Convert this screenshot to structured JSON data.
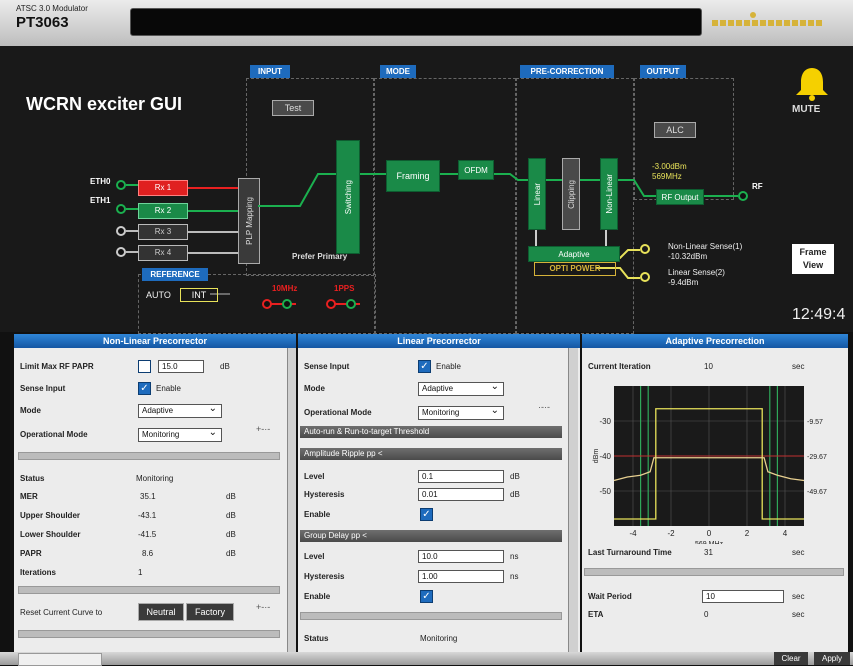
{
  "window": {
    "subtitle": "ATSC 3.0 Modulator",
    "model": "PT3063"
  },
  "diagram": {
    "title": "WCRN exciter GUI",
    "sections": {
      "input": "INPUT",
      "mode": "MODE",
      "precorrection": "PRE-CORRECTION",
      "output": "OUTPUT"
    },
    "test_button": "Test",
    "ports": {
      "eth0": "ETH0",
      "eth1": "ETH1",
      "rf": "RF"
    },
    "rx": [
      "Rx 1",
      "Rx 2",
      "Rx 3",
      "Rx 4"
    ],
    "plp_mapping": "PLP Mapping",
    "switching": "Switching",
    "prefer_primary": "Prefer Primary",
    "framing": "Framing",
    "ofdm": "OFDM",
    "linear": "Linear",
    "clipping": "Clipping",
    "non_linear": "Non-Linear",
    "adaptive": "Adaptive",
    "optipower": "OPTI POWER",
    "alc": "ALC",
    "output_level": "-3.00dBm",
    "output_freq": "569MHz",
    "rf_output": "RF Output",
    "reference": "REFERENCE",
    "auto": "AUTO",
    "int": "INT",
    "ref_10mhz": "10MHz",
    "ref_1pps": "1PPS",
    "nl_sense_label": "Non-Linear Sense(1)",
    "nl_sense_value": "-10.32dBm",
    "lin_sense_label": "Linear Sense(2)",
    "lin_sense_value": "-9.4dBm",
    "mute": "MUTE",
    "frame_view": "Frame View",
    "clock": "12:49:4"
  },
  "nonlinear": {
    "header": "Non-Linear Precorrector",
    "limit_label": "Limit Max RF PAPR",
    "limit_value": "15.0",
    "limit_unit": "dB",
    "sense_label": "Sense Input",
    "enable": "Enable",
    "mode_label": "Mode",
    "mode_value": "Adaptive",
    "op_label": "Operational Mode",
    "op_value": "Monitoring",
    "status_label": "Status",
    "status_value": "Monitoring",
    "stats": [
      {
        "label": "MER",
        "value": "35.1",
        "unit": "dB"
      },
      {
        "label": "Upper Shoulder",
        "value": "-43.1",
        "unit": "dB"
      },
      {
        "label": "Lower Shoulder",
        "value": "-41.5",
        "unit": "dB"
      },
      {
        "label": "PAPR",
        "value": "8.6",
        "unit": "dB"
      },
      {
        "label": "Iterations",
        "value": "1",
        "unit": ""
      }
    ],
    "reset_label": "Reset Current Curve to",
    "neutral": "Neutral",
    "factory": "Factory"
  },
  "linear": {
    "header": "Linear Precorrector",
    "sense_label": "Sense Input",
    "enable": "Enable",
    "mode_label": "Mode",
    "mode_value": "Adaptive",
    "op_label": "Operational Mode",
    "op_value": "Monitoring",
    "auto_run": "Auto-run & Run-to-target Threshold",
    "amp_ripple": "Amplitude Ripple pp <",
    "level_label": "Level",
    "amp_level": "0.1",
    "amp_level_unit": "dB",
    "hyst_label": "Hysteresis",
    "amp_hyst": "0.01",
    "amp_hyst_unit": "dB",
    "enable_label": "Enable",
    "group_delay": "Group Delay pp <",
    "gd_level": "10.0",
    "gd_level_unit": "ns",
    "gd_hyst": "1.00",
    "gd_hyst_unit": "ns",
    "status_label": "Status",
    "status_value": "Monitoring"
  },
  "adaptive": {
    "header": "Adaptive Precorrection",
    "iter_label": "Current Iteration",
    "iter_value": "10",
    "iter_unit": "sec",
    "last_label": "Last Turnaround Time",
    "last_value": "31",
    "last_unit": "sec",
    "wait_label": "Wait Period",
    "wait_value": "10",
    "wait_unit": "sec",
    "eta_label": "ETA",
    "eta_value": "0",
    "eta_unit": "sec"
  },
  "chart_data": {
    "type": "line",
    "title": "",
    "xlabel": "569 MHz",
    "ylabel": "dBm",
    "xlim": [
      -5,
      5
    ],
    "ylim": [
      -60,
      -20
    ],
    "x_ticks": [
      "-4",
      "-2",
      "0",
      "2",
      "4"
    ],
    "y_ticks": [
      "-30",
      "-40",
      "-50"
    ],
    "right_labels": [
      "-9.57",
      "-29.67",
      "-49.67"
    ],
    "series": [
      {
        "color": "#e8e25a",
        "x": [
          -5,
          -4.5,
          -3.2,
          -2.8,
          -2.8,
          2.8,
          2.8,
          3.2,
          4.5,
          5
        ],
        "y": [
          -58,
          -58,
          -58,
          -58,
          -26.5,
          -26.5,
          -58,
          -58,
          -58,
          -58
        ]
      },
      {
        "color": "#e8d090",
        "x": [
          -5,
          -4.3,
          -3.6,
          -3.1,
          -2.9,
          2.9,
          3.1,
          3.6,
          4.3,
          5
        ],
        "y": [
          -47,
          -46,
          -45.5,
          -44.5,
          -40.5,
          -40.5,
          -44.5,
          -45.5,
          -46.5,
          -47
        ]
      }
    ],
    "grid": true
  },
  "bottom": {
    "clear": "Clear",
    "apply": "Apply"
  }
}
